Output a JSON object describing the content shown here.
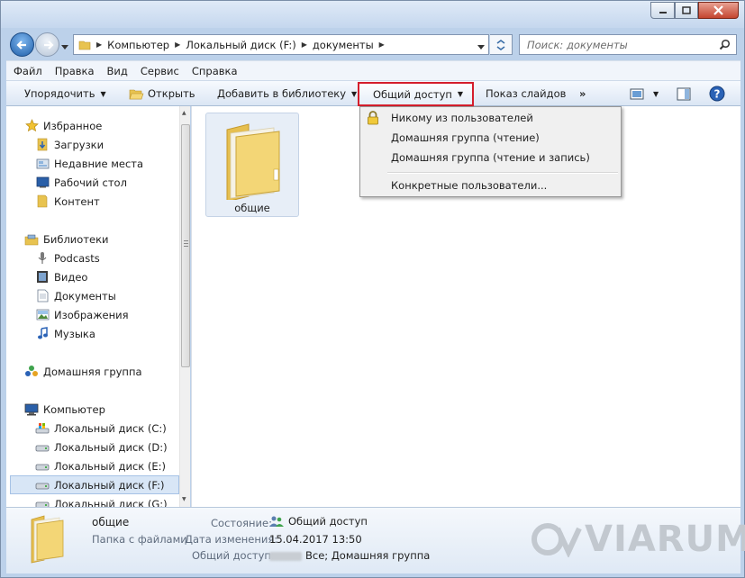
{
  "address": {
    "crumbs": [
      "Компьютер",
      "Локальный диск (F:)",
      "документы"
    ]
  },
  "search": {
    "placeholder": "Поиск: документы"
  },
  "menu": [
    "Файл",
    "Правка",
    "Вид",
    "Сервис",
    "Справка"
  ],
  "toolbar": {
    "organize": "Упорядочить",
    "open": "Открыть",
    "add_library": "Добавить в библиотеку",
    "share": "Общий доступ",
    "slideshow": "Показ слайдов",
    "more": "»"
  },
  "share_menu": [
    "Никому из пользователей",
    "Домашняя группа (чтение)",
    "Домашняя группа (чтение и запись)",
    "Конкретные пользователи..."
  ],
  "nav": {
    "favorites": "Избранное",
    "fav_items": [
      "Загрузки",
      "Недавние места",
      "Рабочий стол",
      "Контент"
    ],
    "libraries": "Библиотеки",
    "lib_items": [
      "Podcasts",
      "Видео",
      "Документы",
      "Изображения",
      "Музыка"
    ],
    "homegroup": "Домашняя группа",
    "computer": "Компьютер",
    "drives": [
      "Локальный диск (C:)",
      "Локальный диск (D:)",
      "Локальный диск (E:)",
      "Локальный диск (F:)",
      "Локальный диск (G:)"
    ]
  },
  "content": {
    "folder_name": "общие"
  },
  "details": {
    "name": "общие",
    "type": "Папка с файлами",
    "state_label": "Состояние:",
    "state_value": "Общий доступ",
    "modified_label": "Дата изменения:",
    "modified_value": "15.04.2017 13:50",
    "sharing_label": "Общий доступ:",
    "sharing_value": "Все; Домашняя группа"
  },
  "watermark": "VIARUM",
  "colors": {
    "highlight_border": "#d41e2c",
    "folder": "#f2d16a"
  }
}
